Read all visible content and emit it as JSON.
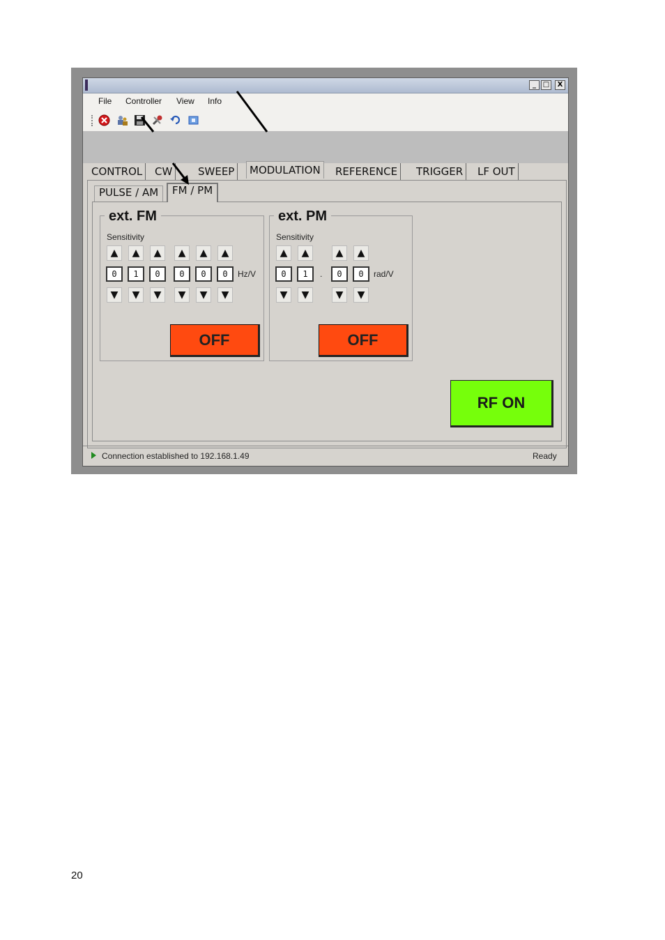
{
  "window": {
    "controls": {
      "minimize": "_",
      "maximize": "□",
      "close": "X"
    }
  },
  "menubar": [
    "File",
    "Controller",
    "View",
    "Info"
  ],
  "toolbar_icons": [
    "close-red-icon",
    "settings-people-icon",
    "save-icon",
    "tools-icon",
    "undo-icon",
    "refresh-icon"
  ],
  "tabs": [
    "CONTROL",
    "CW",
    "SWEEP",
    "MODULATION",
    "REFERENCE",
    "TRIGGER",
    "LF OUT"
  ],
  "active_tab": "MODULATION",
  "subtabs": [
    "PULSE / AM",
    "FM / PM"
  ],
  "active_subtab": "FM / PM",
  "fm": {
    "title": "ext. FM",
    "sensitivity_label": "Sensitivity",
    "up": "▲",
    "down": "▼",
    "digits": [
      "0",
      "1",
      "0",
      "0",
      "0",
      "0"
    ],
    "unit": "Hz/V",
    "button": "OFF"
  },
  "pm": {
    "title": "ext. PM",
    "sensitivity_label": "Sensitivity",
    "up": "▲",
    "down": "▼",
    "digits": [
      "0",
      "1",
      "0",
      "0"
    ],
    "decimal": ".",
    "unit": "rad/V",
    "button": "OFF"
  },
  "rf_button": "RF ON",
  "status": {
    "message": "Connection established to 192.168.1.49",
    "state": "Ready"
  },
  "page_number": "20",
  "colors": {
    "off_button": "#ff4a10",
    "rf_on_button": "#76ff0b"
  }
}
